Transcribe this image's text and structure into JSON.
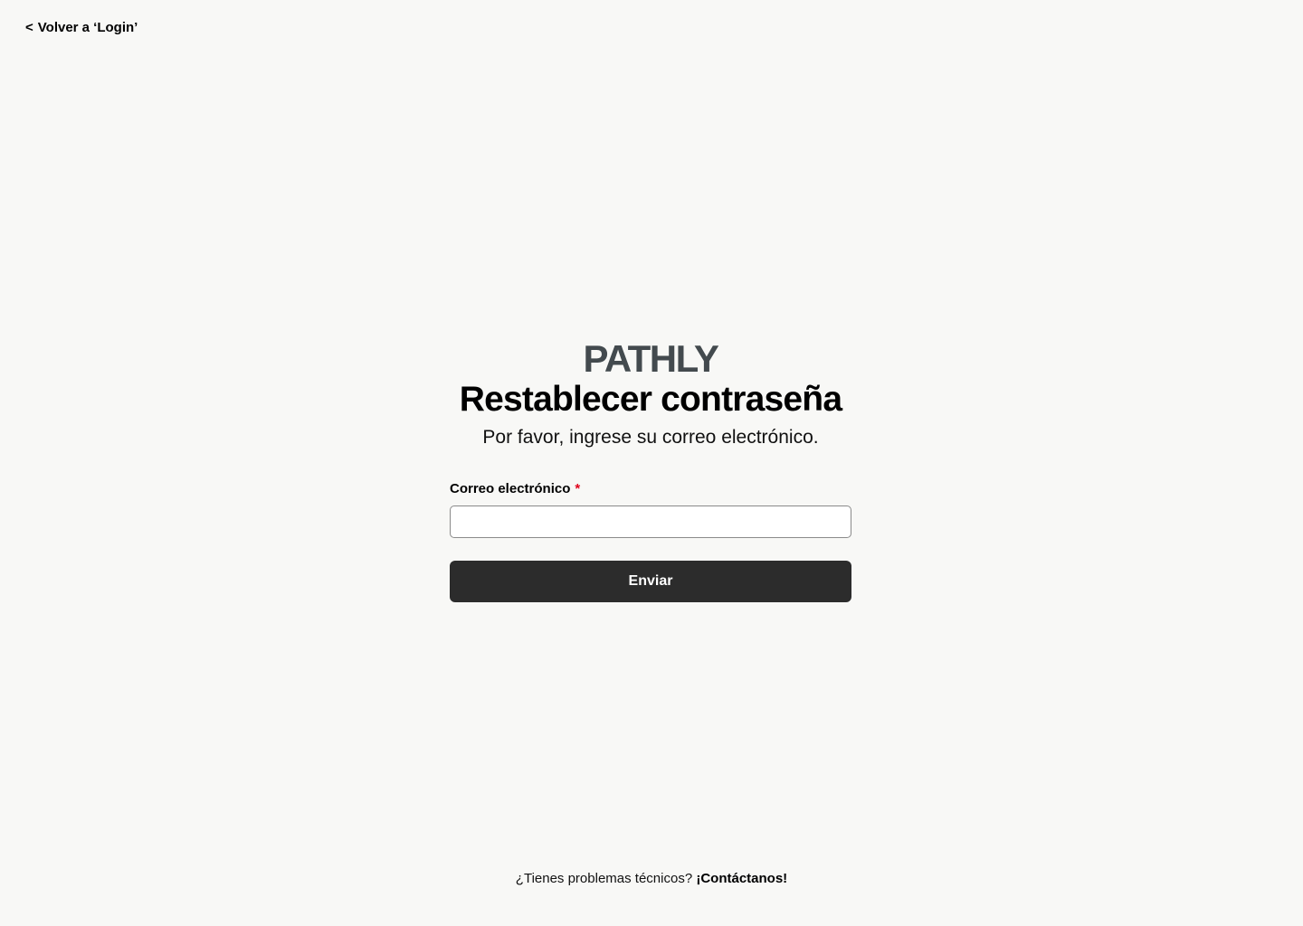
{
  "back_link": {
    "chevron": "<",
    "label": "Volver a ‘Login’"
  },
  "brand": {
    "name": "PATHLY",
    "color": "#434a4e"
  },
  "header": {
    "title": "Restablecer contraseña",
    "subtitle": "Por favor, ingrese su correo electrónico."
  },
  "form": {
    "email_label": "Correo electrónico",
    "required_mark": "*",
    "email_value": "",
    "submit_label": "Enviar"
  },
  "footer": {
    "question": "¿Tienes problemas técnicos?",
    "contact_label": "¡Contáctanos!"
  },
  "colors": {
    "background": "#f8f8f6",
    "button": "#2c2c2c",
    "required": "#e0001b"
  }
}
